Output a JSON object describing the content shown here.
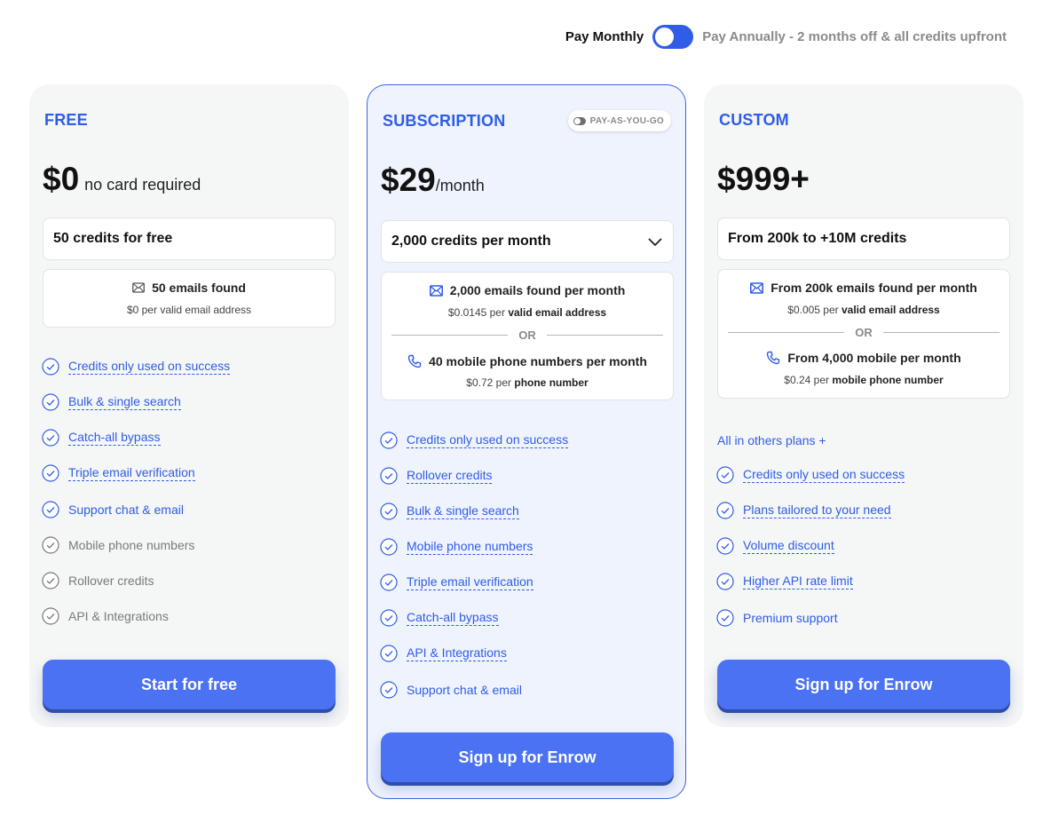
{
  "billing": {
    "monthly_label": "Pay Monthly",
    "annual_label": "Pay Annually - 2 months off & all credits upfront"
  },
  "plans": {
    "free": {
      "name": "FREE",
      "price": "$0",
      "price_suffix": "no card required",
      "credits": "50 credits for free",
      "emails_title": "50 emails found",
      "emails_price": "$0 per valid email address",
      "features": [
        {
          "label": "Credits only used on success",
          "included": true
        },
        {
          "label": "Bulk & single search",
          "included": true
        },
        {
          "label": "Catch-all bypass",
          "included": true
        },
        {
          "label": "Triple email verification",
          "included": true
        },
        {
          "label": "Support chat & email",
          "included": true
        },
        {
          "label": "Mobile phone numbers",
          "included": false
        },
        {
          "label": "Rollover credits",
          "included": false
        },
        {
          "label": "API & Integrations",
          "included": false
        }
      ],
      "cta": "Start for free"
    },
    "subscription": {
      "name": "SUBSCRIPTION",
      "payg_label": "PAY-AS-YOU-GO",
      "price": "$29",
      "price_suffix": "/month",
      "credits": "2,000 credits per month",
      "emails_title": "2,000 emails found per month",
      "emails_price": "$0.0145 per",
      "emails_unit": "valid email address",
      "or_label": "OR",
      "phones_title": "40 mobile phone numbers per month",
      "phones_price": "$0.72 per",
      "phones_unit": "phone number",
      "features": [
        {
          "label": "Credits only used on success",
          "included": true
        },
        {
          "label": "Rollover credits",
          "included": true
        },
        {
          "label": "Bulk & single search",
          "included": true
        },
        {
          "label": "Mobile phone numbers",
          "included": true
        },
        {
          "label": "Triple email verification",
          "included": true
        },
        {
          "label": "Catch-all bypass",
          "included": true
        },
        {
          "label": "API & Integrations",
          "included": true
        },
        {
          "label": "Support chat & email",
          "included": true
        }
      ],
      "cta": "Sign up for Enrow"
    },
    "custom": {
      "name": "CUSTOM",
      "price": "$999+",
      "credits": "From 200k to +10M credits",
      "emails_title": "From 200k emails found per month",
      "emails_price": "$0.005 per",
      "emails_unit": "valid email address",
      "or_label": "OR",
      "phones_title": "From 4,000 mobile per month",
      "phones_price": "$0.24 per",
      "phones_unit": "mobile phone number",
      "all_in_label": "All in others plans +",
      "features": [
        {
          "label": "Credits only used on success",
          "included": true
        },
        {
          "label": "Plans tailored to your need",
          "included": true
        },
        {
          "label": "Volume discount",
          "included": true
        },
        {
          "label": "Higher API rate limit",
          "included": true
        },
        {
          "label": "Premium support",
          "included": true
        }
      ],
      "cta": "Sign up for Enrow"
    }
  },
  "colors": {
    "accent": "#2f5de8",
    "button": "#4a72f2",
    "muted": "#7a7a7a"
  }
}
